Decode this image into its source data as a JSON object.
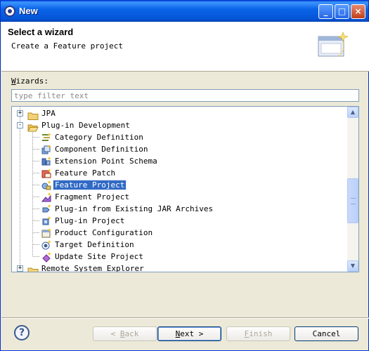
{
  "window": {
    "title": "New",
    "controls": {
      "minimize": "_",
      "maximize": "□",
      "close": "×"
    }
  },
  "header": {
    "title": "Select a wizard",
    "description": "Create a Feature project",
    "graphic_icon": "wizard-banner-graphic"
  },
  "wizards_label": {
    "mnemonic": "W",
    "rest": "izards:"
  },
  "filter": {
    "value": "",
    "placeholder": "type filter text"
  },
  "tree": {
    "items": [
      {
        "label": "JPA",
        "icon": "folder-icon",
        "level": 1,
        "expander": "+"
      },
      {
        "label": "Plug-in Development",
        "icon": "folder-open-icon",
        "level": 1,
        "expander": "-"
      },
      {
        "label": "Category Definition",
        "icon": "category-definition-icon",
        "level": 2
      },
      {
        "label": "Component Definition",
        "icon": "component-definition-icon",
        "level": 2
      },
      {
        "label": "Extension Point Schema",
        "icon": "extension-point-schema-icon",
        "level": 2
      },
      {
        "label": "Feature Patch",
        "icon": "feature-patch-icon",
        "level": 2
      },
      {
        "label": "Feature Project",
        "icon": "feature-project-icon",
        "level": 2,
        "selected": true
      },
      {
        "label": "Fragment Project",
        "icon": "fragment-project-icon",
        "level": 2
      },
      {
        "label": "Plug-in from Existing JAR Archives",
        "icon": "plugin-from-jar-icon",
        "level": 2
      },
      {
        "label": "Plug-in Project",
        "icon": "plugin-project-icon",
        "level": 2
      },
      {
        "label": "Product Configuration",
        "icon": "product-configuration-icon",
        "level": 2
      },
      {
        "label": "Target Definition",
        "icon": "target-definition-icon",
        "level": 2
      },
      {
        "label": "Update Site Project",
        "icon": "update-site-project-icon",
        "level": 2
      },
      {
        "label": "Remote System Explorer",
        "icon": "folder-icon",
        "level": 1,
        "expander": "+"
      }
    ]
  },
  "scrollbar": {
    "up_icon": "▲",
    "down_icon": "▼"
  },
  "footer": {
    "help_icon": "?",
    "back": {
      "prefix": "< ",
      "mnemonic": "B",
      "rest": "ack",
      "enabled": false
    },
    "next": {
      "mnemonic": "N",
      "rest": "ext >",
      "enabled": true,
      "default": true
    },
    "finish": {
      "mnemonic": "F",
      "rest": "inish",
      "enabled": false
    },
    "cancel": {
      "label": "Cancel",
      "enabled": true
    }
  }
}
